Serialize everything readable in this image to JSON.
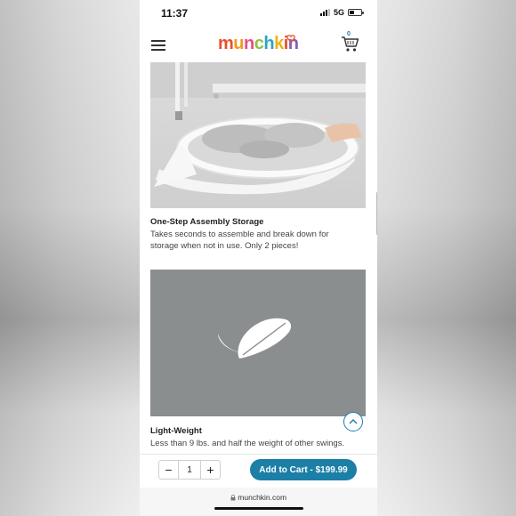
{
  "status": {
    "time": "11:37",
    "network": "5G",
    "battery_level": 0.45
  },
  "header": {
    "logo_letters": [
      "m",
      "u",
      "n",
      "c",
      "h",
      "k",
      "i",
      "n"
    ],
    "cart_count": "0"
  },
  "features": [
    {
      "title": "One-Step Assembly Storage",
      "description": "Takes seconds to assemble and break down for storage when not in use. Only 2 pieces!"
    },
    {
      "title": "Light-Weight",
      "description": "Less than 9 lbs. and half the weight of other swings."
    }
  ],
  "cart_bar": {
    "minus": "−",
    "quantity": "1",
    "plus": "+",
    "add_label": "Add to Cart - $199.99"
  },
  "browser": {
    "url": "munchkin.com"
  },
  "colors": {
    "accent": "#1b7fa6",
    "feather_bg": "#8a8e8f"
  }
}
